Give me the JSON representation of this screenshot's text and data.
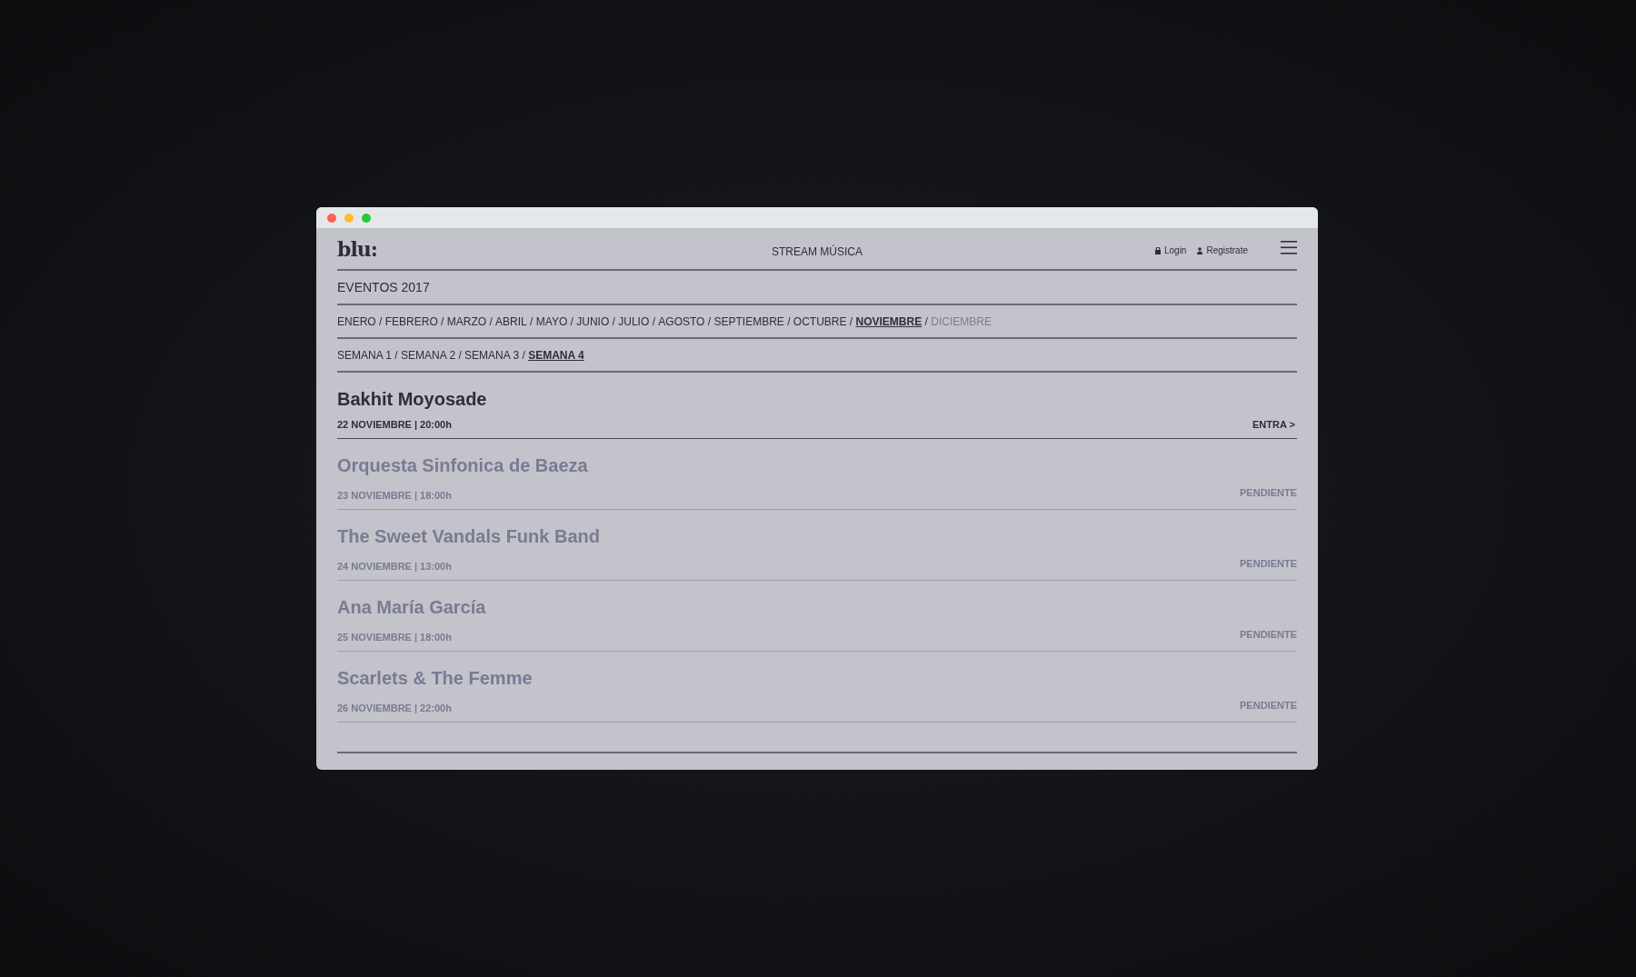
{
  "window": {
    "controls": [
      {
        "color": "#ff5f57"
      },
      {
        "color": "#febc2e"
      },
      {
        "color": "#28c840"
      }
    ]
  },
  "nav_separator": "/",
  "header": {
    "logo": "blu:",
    "nav_title": "STREAM MÚSICA",
    "login": "Login",
    "register": "Registrate"
  },
  "section_title": "EVENTOS 2017",
  "months": [
    {
      "label": "ENERO",
      "selected": false,
      "disabled": false
    },
    {
      "label": "FEBRERO",
      "selected": false,
      "disabled": false
    },
    {
      "label": "MARZO",
      "selected": false,
      "disabled": false
    },
    {
      "label": "ABRIL",
      "selected": false,
      "disabled": false
    },
    {
      "label": "MAYO",
      "selected": false,
      "disabled": false
    },
    {
      "label": "JUNIO",
      "selected": false,
      "disabled": false
    },
    {
      "label": "JULIO",
      "selected": false,
      "disabled": false
    },
    {
      "label": "AGOSTO",
      "selected": false,
      "disabled": false
    },
    {
      "label": "SEPTIEMBRE",
      "selected": false,
      "disabled": false
    },
    {
      "label": "OCTUBRE",
      "selected": false,
      "disabled": false
    },
    {
      "label": "NOVIEMBRE",
      "selected": true,
      "disabled": false
    },
    {
      "label": "DICIEMBRE",
      "selected": false,
      "disabled": true
    }
  ],
  "weeks": [
    {
      "label": "SEMANA 1",
      "selected": false
    },
    {
      "label": "SEMANA 2",
      "selected": false
    },
    {
      "label": "SEMANA 3",
      "selected": false
    },
    {
      "label": "SEMANA 4",
      "selected": true
    }
  ],
  "events": [
    {
      "title": "Bakhit Moyosade",
      "date": "22 NOVIEMBRE | 20:00h",
      "action": "ENTRA >",
      "kind": "active"
    },
    {
      "title": "Orquesta Sinfonica de Baeza",
      "date": "23 NOVIEMBRE | 18:00h",
      "action": "PENDIENTE",
      "kind": "pending"
    },
    {
      "title": "The Sweet Vandals Funk Band",
      "date": "24 NOVIEMBRE | 13:00h",
      "action": "PENDIENTE",
      "kind": "pending"
    },
    {
      "title": "Ana María García",
      "date": "25 NOVIEMBRE | 18:00h",
      "action": "PENDIENTE",
      "kind": "pending"
    },
    {
      "title": "Scarlets & The Femme",
      "date": "26 NOVIEMBRE | 22:00h",
      "action": "PENDIENTE",
      "kind": "pending"
    }
  ]
}
